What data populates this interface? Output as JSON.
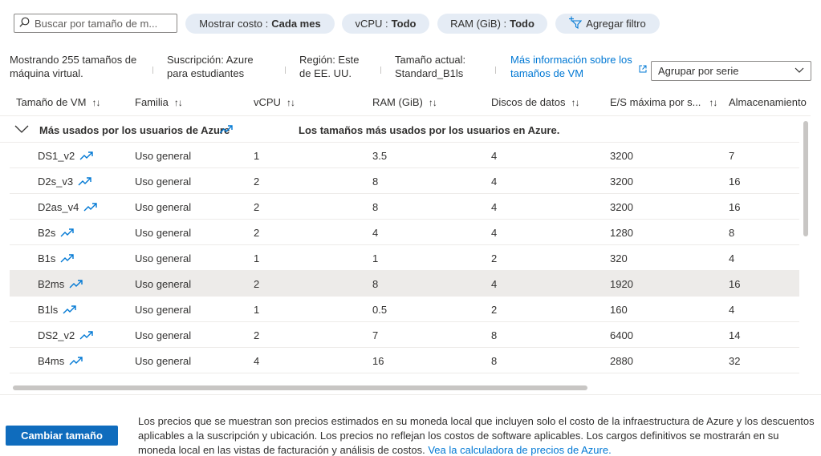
{
  "search": {
    "placeholder": "Buscar por tamaño de m..."
  },
  "filters": [
    {
      "label": "Mostrar costo :",
      "value": "Cada mes"
    },
    {
      "label": "vCPU :",
      "value": "Todo"
    },
    {
      "label": "RAM (GiB) :",
      "value": "Todo"
    }
  ],
  "add_filter_label": "Agregar filtro",
  "info": {
    "count_line1": "Mostrando 255 tamaños de",
    "count_line2": "máquina virtual.",
    "subscription_line1": "Suscripción: Azure",
    "subscription_line2": "para estudiantes",
    "region_line1": "Región: Este",
    "region_line2": "de EE. UU.",
    "current_line1": "Tamaño actual:",
    "current_line2": "Standard_B1ls",
    "more_info_line1": "Más información sobre los",
    "more_info_line2": "tamaños de VM"
  },
  "group_by": {
    "selected": "Agrupar por serie"
  },
  "columns": [
    "Tamaño de VM",
    "Familia",
    "vCPU",
    "RAM (GiB)",
    "Discos de datos",
    "E/S máxima por s...",
    "Almacenamiento"
  ],
  "group": {
    "name": "Más usados por los usuarios de Azure",
    "description": "Los tamaños más usados por los usuarios en Azure."
  },
  "rows": [
    {
      "size": "DS1_v2",
      "family": "Uso general",
      "vcpu": "1",
      "ram": "3.5",
      "disks": "4",
      "iops": "3200",
      "storage": "7"
    },
    {
      "size": "D2s_v3",
      "family": "Uso general",
      "vcpu": "2",
      "ram": "8",
      "disks": "4",
      "iops": "3200",
      "storage": "16"
    },
    {
      "size": "D2as_v4",
      "family": "Uso general",
      "vcpu": "2",
      "ram": "8",
      "disks": "4",
      "iops": "3200",
      "storage": "16"
    },
    {
      "size": "B2s",
      "family": "Uso general",
      "vcpu": "2",
      "ram": "4",
      "disks": "4",
      "iops": "1280",
      "storage": "8"
    },
    {
      "size": "B1s",
      "family": "Uso general",
      "vcpu": "1",
      "ram": "1",
      "disks": "2",
      "iops": "320",
      "storage": "4"
    },
    {
      "size": "B2ms",
      "family": "Uso general",
      "vcpu": "2",
      "ram": "8",
      "disks": "4",
      "iops": "1920",
      "storage": "16"
    },
    {
      "size": "B1ls",
      "family": "Uso general",
      "vcpu": "1",
      "ram": "0.5",
      "disks": "2",
      "iops": "160",
      "storage": "4"
    },
    {
      "size": "DS2_v2",
      "family": "Uso general",
      "vcpu": "2",
      "ram": "7",
      "disks": "8",
      "iops": "6400",
      "storage": "14"
    },
    {
      "size": "B4ms",
      "family": "Uso general",
      "vcpu": "4",
      "ram": "16",
      "disks": "8",
      "iops": "2880",
      "storage": "32"
    }
  ],
  "selected_row": "B2ms",
  "icons": {
    "trend": "trending-up-icon",
    "search": "search-icon",
    "add_filter": "add-filter-icon",
    "external": "external-link-icon",
    "chevron": "chevron-down-icon"
  },
  "colors": {
    "accent": "#0078d4",
    "primary_button": "#0f6cbd",
    "pill_bg": "#e5ecf5",
    "selected_row": "#edebe9"
  },
  "footer": {
    "button_label": "Cambiar tamaño",
    "note_text": "Los precios que se muestran son precios estimados en su moneda local que incluyen solo el costo de la infraestructura de Azure y los descuentos aplicables a la suscripción y ubicación. Los precios no reflejan los costos de software aplicables. Los cargos definitivos se mostrarán en su moneda local en las vistas de facturación y análisis de costos.",
    "note_link": "Vea la calculadora de precios de Azure."
  }
}
